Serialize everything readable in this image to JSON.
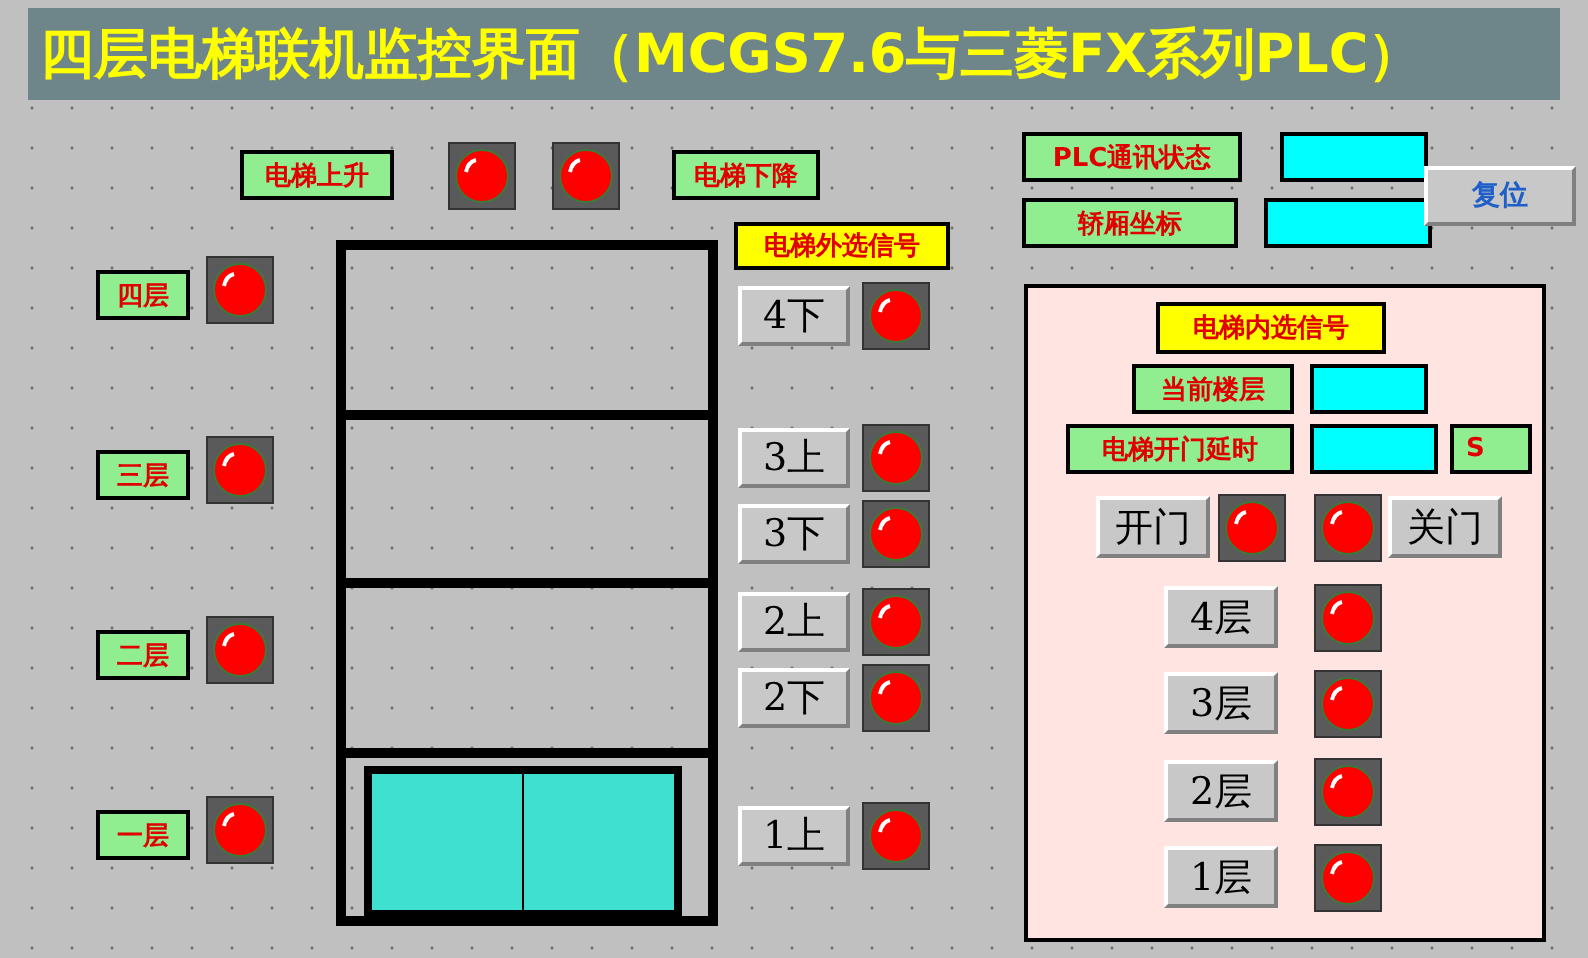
{
  "title": "四层电梯联机监控界面（MCGS7.6与三菱FX系列PLC）",
  "motion": [
    {
      "label": "电梯上升",
      "on": false
    },
    {
      "label": "电梯下降",
      "on": false
    }
  ],
  "status_fields": [
    {
      "label": "PLC通讯状态"
    },
    {
      "label": "轿厢坐标"
    }
  ],
  "reset_button": "复位",
  "floor_indicators": [
    {
      "label": "四层",
      "on": false
    },
    {
      "label": "三层",
      "on": false
    },
    {
      "label": "二层",
      "on": false
    },
    {
      "label": "一层",
      "on": false
    }
  ],
  "shaft": {
    "floors": [
      {
        "car": false
      },
      {
        "car": false
      },
      {
        "car": false
      },
      {
        "car": true
      }
    ]
  },
  "hall_calls": {
    "title": "电梯外选信号",
    "buttons": [
      {
        "label": "4下",
        "on": false
      },
      {
        "label": "3上",
        "on": false
      },
      {
        "label": "3下",
        "on": false
      },
      {
        "label": "2上",
        "on": false
      },
      {
        "label": "2下",
        "on": false
      },
      {
        "label": "1上",
        "on": false
      }
    ]
  },
  "car_panel": {
    "title": "电梯内选信号",
    "current_floor_label": "当前楼层",
    "door_delay_label": "电梯开门延时",
    "unit": "S",
    "door_buttons": [
      {
        "label": "开门",
        "on": false
      },
      {
        "label": "关门",
        "on": false
      }
    ],
    "floor_buttons": [
      {
        "label": "4层",
        "on": false
      },
      {
        "label": "3层",
        "on": false
      },
      {
        "label": "2层",
        "on": false
      },
      {
        "label": "1层",
        "on": false
      }
    ]
  }
}
